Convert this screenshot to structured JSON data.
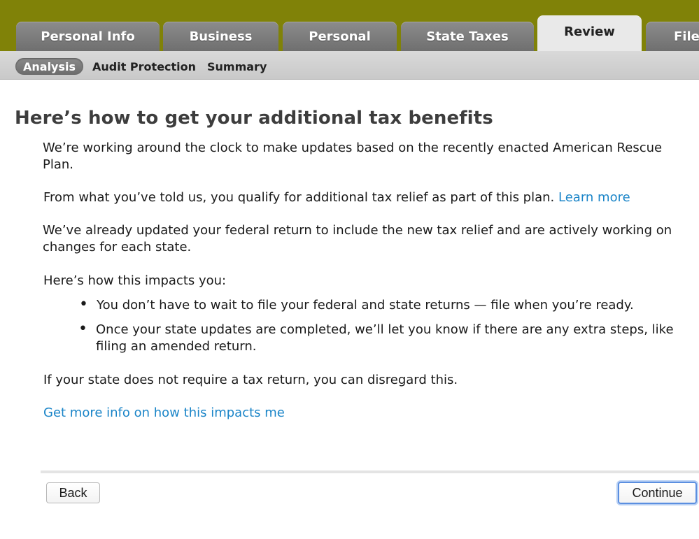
{
  "tabs": [
    {
      "label": "Personal Info",
      "active": false
    },
    {
      "label": "Business",
      "active": false
    },
    {
      "label": "Personal",
      "active": false
    },
    {
      "label": "State Taxes",
      "active": false
    },
    {
      "label": "Review",
      "active": true
    },
    {
      "label": "File",
      "active": false
    }
  ],
  "subnav": [
    {
      "label": "Analysis",
      "active": true
    },
    {
      "label": "Audit Protection",
      "active": false
    },
    {
      "label": "Summary",
      "active": false
    }
  ],
  "main": {
    "title": "Here’s how to get your additional tax benefits",
    "para1": "We’re working around the clock to make updates based on the recently enacted American Rescue Plan.",
    "para2_text": "From what you’ve told us, you qualify for additional tax relief as part of this plan.",
    "para2_link": "Learn more",
    "para3": "We’ve already updated your federal return to include the new tax relief and are actively working on changes for each state.",
    "impacts_intro": "Here’s how this impacts you:",
    "bullets": [
      "You don’t have to wait to file your federal and state returns — file when you’re ready.",
      "Once your state updates are completed, we’ll let you know if there are any extra steps, like filing an amended return."
    ],
    "para4": "If your state does not require a tax return, you can disregard this.",
    "more_info_link": "Get more info on how this impacts me"
  },
  "footer": {
    "back_label": "Back",
    "continue_label": "Continue"
  },
  "colors": {
    "header_olive": "#808208",
    "link_blue": "#1b85c8",
    "primary_focus": "#5b8fe0"
  }
}
